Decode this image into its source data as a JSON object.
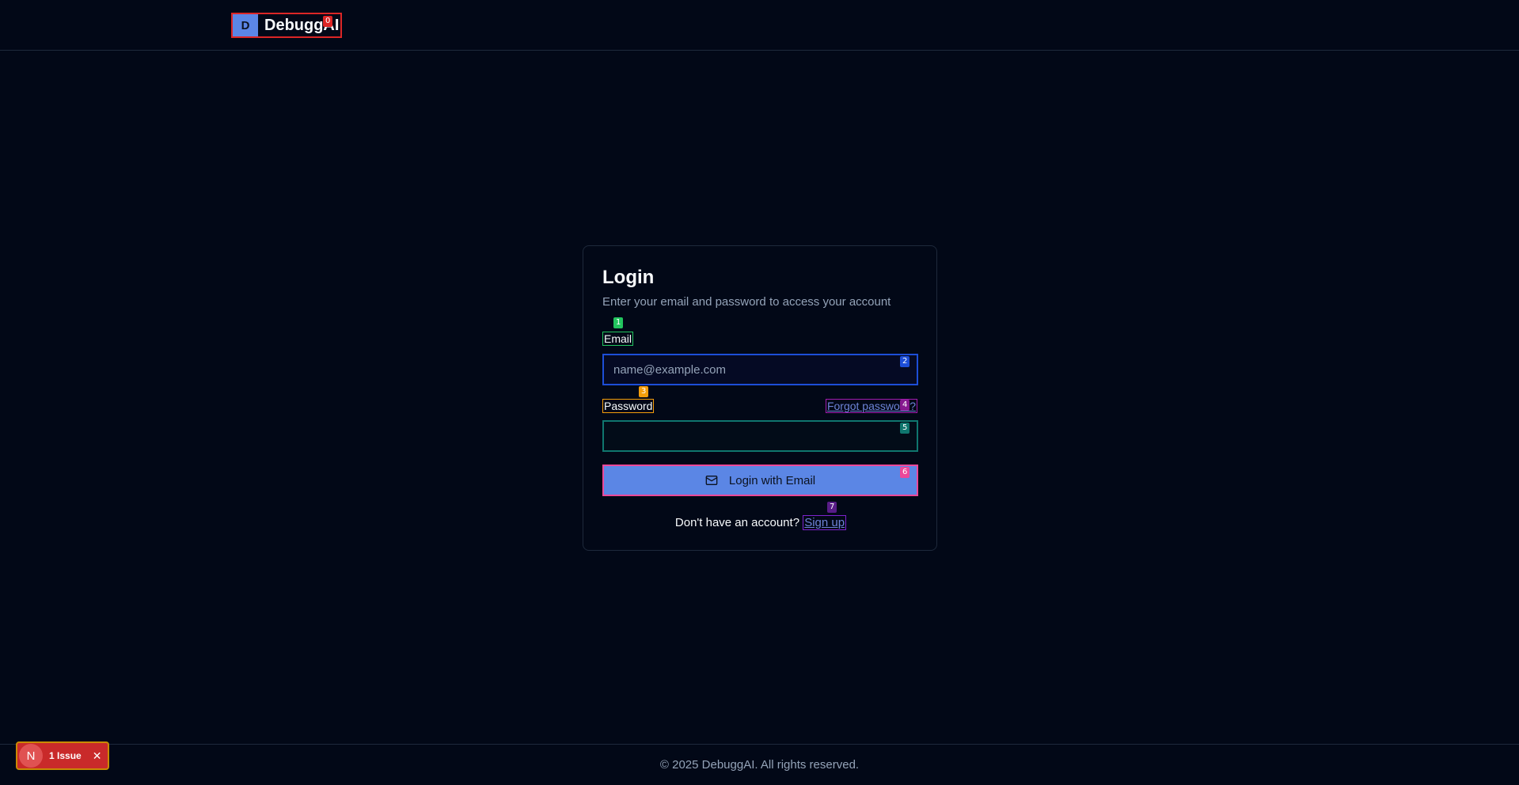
{
  "header": {
    "logo_letter": "D",
    "brand_name": "DebuggAI"
  },
  "login": {
    "title": "Login",
    "subtitle": "Enter your email and password to access your account",
    "email_label": "Email",
    "email_placeholder": "name@example.com",
    "password_label": "Password",
    "forgot_link": "Forgot password?",
    "submit_label": "Login with Email",
    "signup_prompt": "Don't have an account?",
    "signup_link": "Sign up"
  },
  "overlay_tags": [
    "0",
    "1",
    "2",
    "3",
    "4",
    "5",
    "6",
    "7"
  ],
  "footer": {
    "copyright": "© 2025 DebuggAI. All rights reserved."
  },
  "dev_indicator": {
    "letter": "N",
    "issues": "1 Issue",
    "close": "✕"
  },
  "colors": {
    "background": "#020817",
    "primary": "#5b86e5",
    "link": "#6d83d6",
    "muted": "#94a3b8",
    "issue_red": "#c92a2a"
  }
}
